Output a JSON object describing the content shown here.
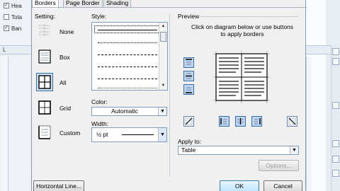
{
  "background": {
    "options": [
      {
        "label": "Hea",
        "checked": true
      },
      {
        "label": "Tota",
        "checked": false
      },
      {
        "label": "Ban",
        "checked": true
      }
    ],
    "ruler_mark": "L"
  },
  "dialog": {
    "tabs": [
      {
        "label": "Borders",
        "active": true
      },
      {
        "label": "Page Border",
        "active": false
      },
      {
        "label": "Shading",
        "active": false
      }
    ],
    "setting": {
      "label": "Setting:",
      "options": [
        {
          "label": "None",
          "selected": false
        },
        {
          "label": "Box",
          "selected": false
        },
        {
          "label": "All",
          "selected": true
        },
        {
          "label": "Grid",
          "selected": false
        },
        {
          "label": "Custom",
          "selected": false
        }
      ]
    },
    "style": {
      "label": "Style:",
      "lines": [
        "solid",
        "dotted",
        "dash-small",
        "dash-medium",
        "dash-dot",
        "dash-dot-dot"
      ]
    },
    "color": {
      "label": "Color:",
      "value": "Automatic"
    },
    "width": {
      "label": "Width:",
      "value": "½ pt"
    },
    "preview": {
      "label": "Preview",
      "instruction": "Click on diagram below or use buttons to apply borders"
    },
    "apply_to": {
      "label": "Apply to:",
      "value": "Table"
    },
    "buttons": {
      "options": "Options...",
      "horizontal_line": "Horizontal Line...",
      "ok": "OK",
      "cancel": "Cancel"
    }
  },
  "colors": {
    "selection": "#cfe0f5",
    "selection_border": "#3a6ea5",
    "dialog_bg": "#f0f0f0"
  }
}
